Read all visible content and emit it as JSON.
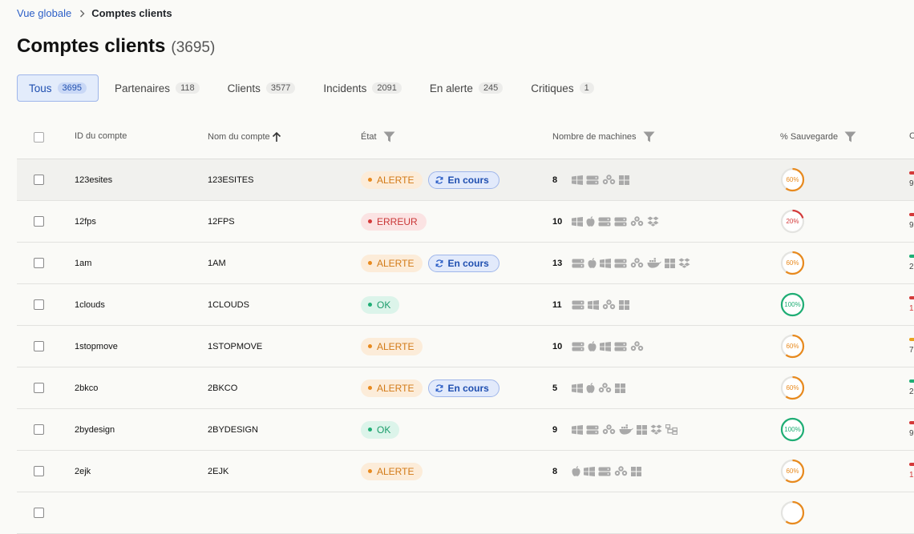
{
  "breadcrumb": {
    "parent": "Vue globale",
    "current": "Comptes clients"
  },
  "page": {
    "title": "Comptes clients",
    "count": "(3695)"
  },
  "tabs": [
    {
      "label": "Tous",
      "count": "3695",
      "active": true
    },
    {
      "label": "Partenaires",
      "count": "118"
    },
    {
      "label": "Clients",
      "count": "3577"
    },
    {
      "label": "Incidents",
      "count": "2091"
    },
    {
      "label": "En alerte",
      "count": "245"
    },
    {
      "label": "Critiques",
      "count": "1"
    }
  ],
  "columns": {
    "id": "ID du compte",
    "name": "Nom du compte",
    "state": "État",
    "machines": "Nombre de machines",
    "backup": "% Sauvegarde",
    "last": "C"
  },
  "status_labels": {
    "alerte": "ALERTE",
    "erreur": "ERREUR",
    "ok": "OK",
    "encours": "En cours"
  },
  "colors": {
    "accent": "#2c5fc7",
    "alerte": "#e88a1e",
    "erreur": "#d43a3a",
    "ok": "#1fae75"
  },
  "rows": [
    {
      "id": "123esites",
      "name": "123ESITES",
      "status": "alerte",
      "in_progress": true,
      "machines": "8",
      "icons": [
        "windows-icon",
        "server-icon",
        "cluster-icon",
        "grid-icon"
      ],
      "backup": 60,
      "last_color": "#d43a3a",
      "last_text": "9"
    },
    {
      "id": "12fps",
      "name": "12FPS",
      "status": "erreur",
      "in_progress": false,
      "machines": "10",
      "icons": [
        "windows-icon",
        "apple-icon",
        "server-icon",
        "server-icon",
        "cluster-icon",
        "dropbox-icon"
      ],
      "backup": 20,
      "last_color": "#d43a3a",
      "last_text": "9"
    },
    {
      "id": "1am",
      "name": "1AM",
      "status": "alerte",
      "in_progress": true,
      "machines": "13",
      "icons": [
        "server-icon",
        "apple-icon",
        "windows-icon",
        "server-icon",
        "cluster-icon",
        "docker-icon",
        "grid-icon",
        "dropbox-icon"
      ],
      "backup": 60,
      "last_color": "#1fae75",
      "last_text": "2"
    },
    {
      "id": "1clouds",
      "name": "1CLOUDS",
      "status": "ok",
      "in_progress": false,
      "machines": "11",
      "icons": [
        "server-icon",
        "windows-icon",
        "cluster-icon",
        "grid-icon"
      ],
      "backup": 100,
      "last_color": "#d43a3a",
      "last_text": "1"
    },
    {
      "id": "1stopmove",
      "name": "1STOPMOVE",
      "status": "alerte",
      "in_progress": false,
      "machines": "10",
      "icons": [
        "server-icon",
        "apple-icon",
        "windows-icon",
        "server-icon",
        "cluster-icon"
      ],
      "backup": 60,
      "last_color": "#e8a21e",
      "last_text": "7"
    },
    {
      "id": "2bkco",
      "name": "2BKCO",
      "status": "alerte",
      "in_progress": true,
      "machines": "5",
      "icons": [
        "windows-icon",
        "apple-icon",
        "cluster-icon",
        "grid-icon"
      ],
      "backup": 60,
      "last_color": "#1fae75",
      "last_text": "2"
    },
    {
      "id": "2bydesign",
      "name": "2BYDESIGN",
      "status": "ok",
      "in_progress": false,
      "machines": "9",
      "icons": [
        "windows-icon",
        "server-icon",
        "cluster-icon",
        "docker-icon",
        "grid-icon",
        "dropbox-icon",
        "tree-icon"
      ],
      "backup": 100,
      "last_color": "#d43a3a",
      "last_text": "9"
    },
    {
      "id": "2ejk",
      "name": "2EJK",
      "status": "alerte",
      "in_progress": false,
      "machines": "8",
      "icons": [
        "apple-icon",
        "windows-icon",
        "server-icon",
        "cluster-icon",
        "grid-icon"
      ],
      "backup": 60,
      "last_color": "#d43a3a",
      "last_text": "1"
    },
    {
      "id": "",
      "name": "",
      "status": "",
      "in_progress": false,
      "machines": "",
      "icons": [],
      "backup": 60,
      "last_color": "",
      "last_text": ""
    }
  ]
}
